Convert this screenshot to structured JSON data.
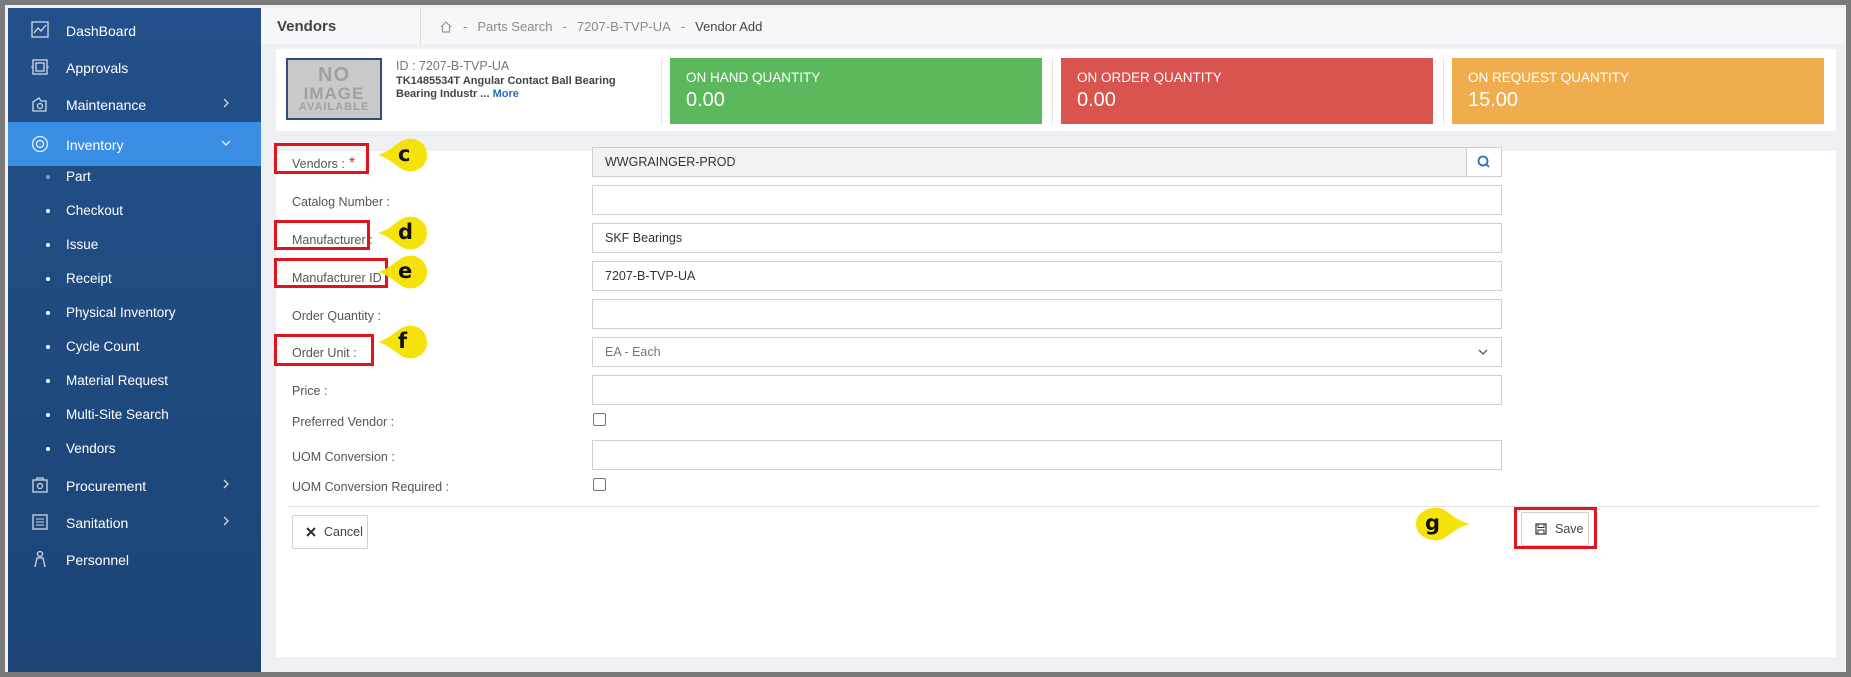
{
  "sidebar": {
    "items": [
      {
        "label": "DashBoard",
        "icon": "chart-icon"
      },
      {
        "label": "Approvals",
        "icon": "approvals-icon"
      },
      {
        "label": "Maintenance",
        "icon": "maintenance-icon"
      },
      {
        "label": "Inventory",
        "icon": "inventory-icon"
      },
      {
        "label": "Procurement",
        "icon": "procurement-icon"
      },
      {
        "label": "Sanitation",
        "icon": "sanitation-icon"
      },
      {
        "label": "Personnel",
        "icon": "personnel-icon"
      }
    ],
    "sub_items": [
      "Part",
      "Checkout",
      "Issue",
      "Receipt",
      "Physical Inventory",
      "Cycle Count",
      "Material Request",
      "Multi-Site Search",
      "Vendors"
    ]
  },
  "header": {
    "title": "Vendors",
    "breadcrumbs": [
      "Parts Search",
      "7207-B-TVP-UA",
      "Vendor Add"
    ],
    "separator": "-"
  },
  "part": {
    "no_image_line1": "NO",
    "no_image_line2": "IMAGE",
    "no_image_line3": "AVAILABLE",
    "id_text": "ID : 7207-B-TVP-UA",
    "description": "TK1485534T Angular Contact Ball Bearing Bearing Industr ...",
    "more_label": "More"
  },
  "quantities": [
    {
      "label": "ON HAND QUANTITY",
      "value": "0.00",
      "color": "#5cb85c"
    },
    {
      "label": "ON ORDER QUANTITY",
      "value": "0.00",
      "color": "#d9534f"
    },
    {
      "label": "ON REQUEST QUANTITY",
      "value": "15.00",
      "color": "#f0ad4e"
    }
  ],
  "form": {
    "vendors_label": "Vendors :",
    "vendors_required": "*",
    "vendors_value": "WWGRAINGER-PROD",
    "catalog_label": "Catalog Number :",
    "catalog_value": "",
    "manufacturer_label": "Manufacturer :",
    "manufacturer_value": "SKF Bearings",
    "manufacturer_id_label": "Manufacturer ID :",
    "manufacturer_id_value": "7207-B-TVP-UA",
    "order_qty_label": "Order Quantity :",
    "order_qty_value": "",
    "order_unit_label": "Order Unit :",
    "order_unit_value": "EA - Each",
    "price_label": "Price :",
    "price_value": "",
    "preferred_vendor_label": "Preferred Vendor :",
    "uom_conversion_label": "UOM Conversion :",
    "uom_conversion_value": "",
    "uom_required_label": "UOM Conversion Required :"
  },
  "buttons": {
    "cancel": "Cancel",
    "save": "Save"
  },
  "callouts": {
    "c": "c",
    "d": "d",
    "e": "e",
    "f": "f",
    "g": "g"
  },
  "colors": {
    "sidebar": "#1f4a7c",
    "active": "#3a8ee6",
    "highlight": "#e0141c",
    "callout": "#f5e20a"
  }
}
